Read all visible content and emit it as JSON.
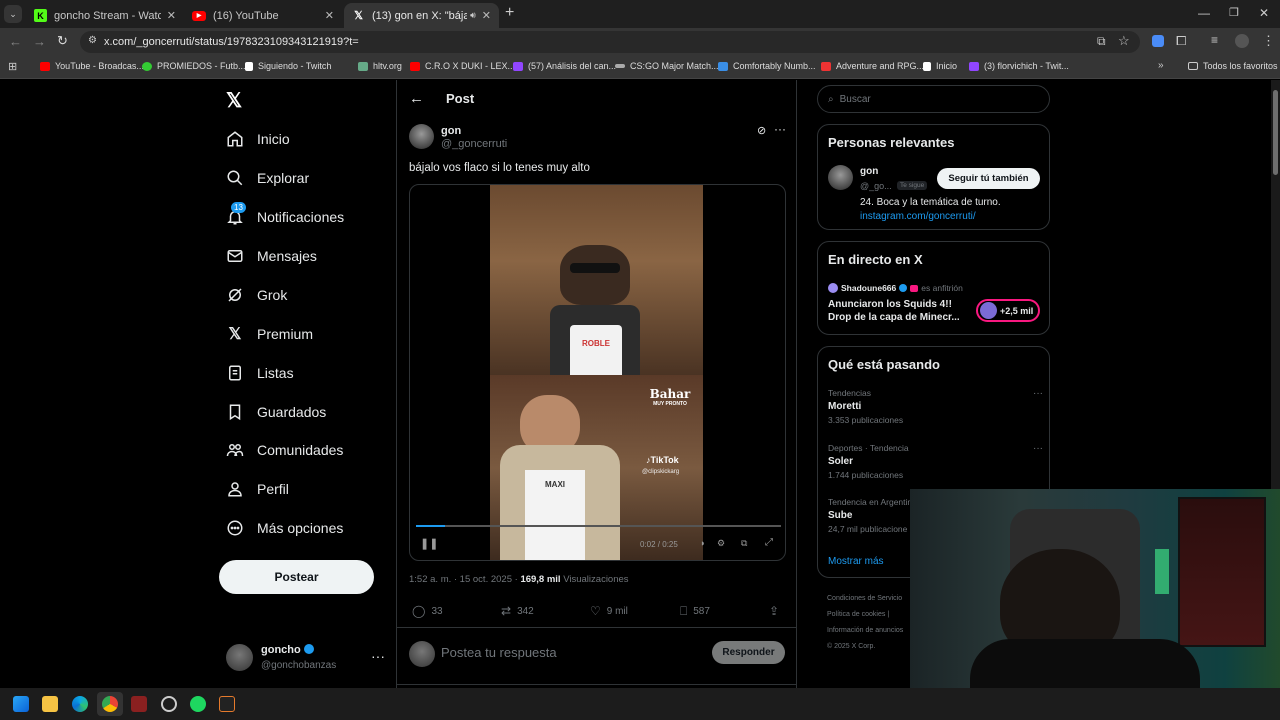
{
  "browser": {
    "tabs": [
      {
        "title": "goncho Stream - Watch Live on",
        "favicon": "kick-icon",
        "active": false
      },
      {
        "title": "(16) YouTube",
        "favicon": "youtube-icon",
        "active": false
      },
      {
        "title": "(13) gon en X: \"bájalo vos fl",
        "favicon": "x-icon",
        "active": true
      }
    ],
    "url": "x.com/_goncerruti/status/1978323109343121919?t=",
    "bookmarks": [
      "YouTube - Broadcas...",
      "PROMIEDOS - Futb...",
      "Siguiendo - Twitch",
      "hltv.org",
      "C.R.O X DUKI - LEX...",
      "(57) Análisis del can...",
      "CS:GO Major Match...",
      "Comfortably Numb...",
      "Adventure and RPG...",
      "Inicio",
      "(3) florvichich - Twit..."
    ],
    "all_bookmarks": "Todos los favoritos"
  },
  "nav": {
    "items": [
      {
        "label": "Inicio",
        "icon": "home-icon"
      },
      {
        "label": "Explorar",
        "icon": "search-icon"
      },
      {
        "label": "Notificaciones",
        "icon": "bell-icon",
        "badge": "13"
      },
      {
        "label": "Mensajes",
        "icon": "mail-icon"
      },
      {
        "label": "Grok",
        "icon": "grok-icon"
      },
      {
        "label": "Premium",
        "icon": "x-icon"
      },
      {
        "label": "Listas",
        "icon": "list-icon"
      },
      {
        "label": "Guardados",
        "icon": "bookmark-icon"
      },
      {
        "label": "Comunidades",
        "icon": "people-icon"
      },
      {
        "label": "Perfil",
        "icon": "person-icon"
      },
      {
        "label": "Más opciones",
        "icon": "more-circle-icon"
      }
    ],
    "post_button": "Postear",
    "account": {
      "name": "goncho",
      "handle": "@gonchobanzas"
    }
  },
  "post": {
    "header": "Post",
    "author_name": "gon",
    "author_handle": "@_goncerruti",
    "text": "bájalo vos flaco si lo tenes muy alto",
    "video": {
      "top_apron": "ROBLE",
      "bottom_apron": "MAXI",
      "watermark_brand": "Bahar",
      "watermark_sub": "MUY PRONTO",
      "tiktok": "TikTok",
      "tiktok_handle": "@clipskickarg",
      "time": "0:02 / 0:25"
    },
    "time": "1:52 a. m. · 15 oct. 2025 ·",
    "views_count": "169,8 mil",
    "views_label": "Visualizaciones",
    "replies": "33",
    "reposts": "342",
    "likes": "9 mil",
    "bookmarks": "587",
    "reply_placeholder": "Postea tu respuesta",
    "reply_button": "Responder"
  },
  "sidebar": {
    "search_placeholder": "Buscar",
    "relevant": {
      "title": "Personas relevantes",
      "name": "gon",
      "handle": "@_go...",
      "follows_you": "Te sigue",
      "follow_button": "Seguir tú también",
      "bio": "24. Boca y la temática de turno.",
      "link": "instagram.com/goncerruti/"
    },
    "live": {
      "title": "En directo en X",
      "host": "Shadoune666",
      "host_role": "es anfitrión",
      "text_line1": "Anunciaron los Squids 4!!",
      "text_line2": "Drop de la capa de Minecr...",
      "listeners": "+2,5 mil"
    },
    "trending": {
      "title": "Qué está pasando",
      "items": [
        {
          "context": "Tendencias",
          "name": "Moretti",
          "count": "3.353 publicaciones"
        },
        {
          "context": "Deportes · Tendencia",
          "name": "Soler",
          "count": "1.744 publicaciones"
        },
        {
          "context": "Tendencia en Argentin",
          "name": "Sube",
          "count": "24,7 mil publicacione"
        }
      ],
      "show_more": "Mostrar más"
    },
    "footer": {
      "terms": "Condiciones de Servicio",
      "cookies": "Política de cookies",
      "ads": "Información de anuncios",
      "copyright": "© 2025 X Corp."
    }
  },
  "colors": {
    "x_blue": "#1d9bf0",
    "bg": "#000000",
    "border": "#2f3336",
    "muted": "#71767b",
    "live_red": "#f91880"
  }
}
